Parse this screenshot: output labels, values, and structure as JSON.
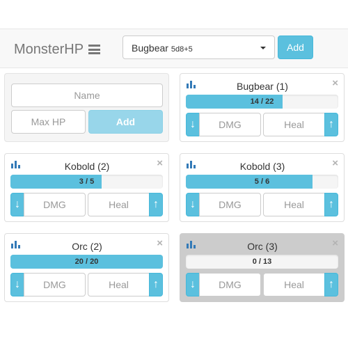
{
  "app": {
    "title": "MonsterHP",
    "menu_icon": "hamburger-icon",
    "select": {
      "name": "Bugbear",
      "dice": "5d8+5"
    },
    "add_label": "Add",
    "accent": "#5bc0de"
  },
  "new_monster_form": {
    "name_placeholder": "Name",
    "maxhp_placeholder": "Max HP",
    "add_label": "Add"
  },
  "monsters": [
    {
      "name": "Bugbear (1)",
      "hp": "14 / 22",
      "hp_fraction": 0.636,
      "dead": false,
      "dmg_placeholder": "DMG",
      "heal_placeholder": "Heal"
    },
    {
      "name": "Kobold (2)",
      "hp": "3 / 5",
      "hp_fraction": 0.6,
      "dead": false,
      "dmg_placeholder": "DMG",
      "heal_placeholder": "Heal"
    },
    {
      "name": "Kobold (3)",
      "hp": "5 / 6",
      "hp_fraction": 0.833,
      "dead": false,
      "dmg_placeholder": "DMG",
      "heal_placeholder": "Heal"
    },
    {
      "name": "Orc (2)",
      "hp": "20 / 20",
      "hp_fraction": 1.0,
      "dead": false,
      "dmg_placeholder": "DMG",
      "heal_placeholder": "Heal"
    },
    {
      "name": "Orc (3)",
      "hp": "0 / 13",
      "hp_fraction": 0.0,
      "dead": true,
      "dmg_placeholder": "DMG",
      "heal_placeholder": "Heal"
    }
  ],
  "icons": {
    "stats": "bar-chart-icon",
    "close": "close-icon",
    "damage": "arrow-down-icon",
    "heal": "arrow-up-icon"
  },
  "glyphs": {
    "close": "×",
    "down": "↓",
    "up": "↑"
  }
}
